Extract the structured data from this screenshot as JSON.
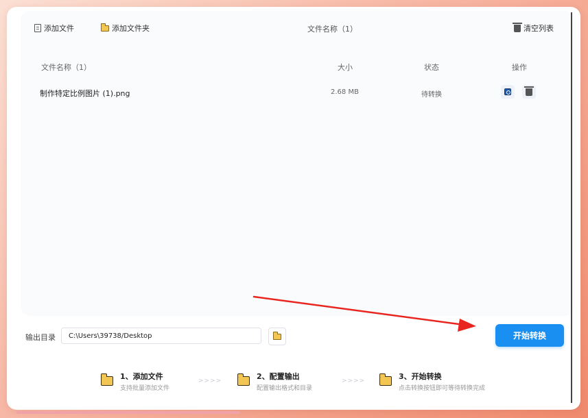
{
  "toolbar": {
    "add_file": "添加文件",
    "add_folder": "添加文件夹",
    "title": "文件名称（1）",
    "clear_list": "清空列表"
  },
  "table": {
    "columns": {
      "name": "文件名称（1）",
      "size": "大小",
      "status": "状态",
      "actions": "操作"
    },
    "rows": [
      {
        "name": "制作特定比例图片 (1).png",
        "size": "2.68 MB",
        "status": "待转换",
        "actions": [
          "convert-icon",
          "trash-icon"
        ]
      }
    ]
  },
  "output": {
    "label": "输出目录",
    "path": "C:\\Users\\39738/Desktop"
  },
  "start_button": "开始转换",
  "steps": [
    {
      "title": "1、添加文件",
      "desc": "支持批量添加文件"
    },
    {
      "title": "2、配置输出",
      "desc": "配置输出格式和目录"
    },
    {
      "title": "3、开始转换",
      "desc": "点击转换按钮即可等待转换完成"
    }
  ],
  "step_separator": ">>>>",
  "colors": {
    "accent": "#1a8ff2",
    "folder": "#f3c553",
    "annotation_arrow": "#e8251f",
    "background": "#f7b9a6"
  }
}
